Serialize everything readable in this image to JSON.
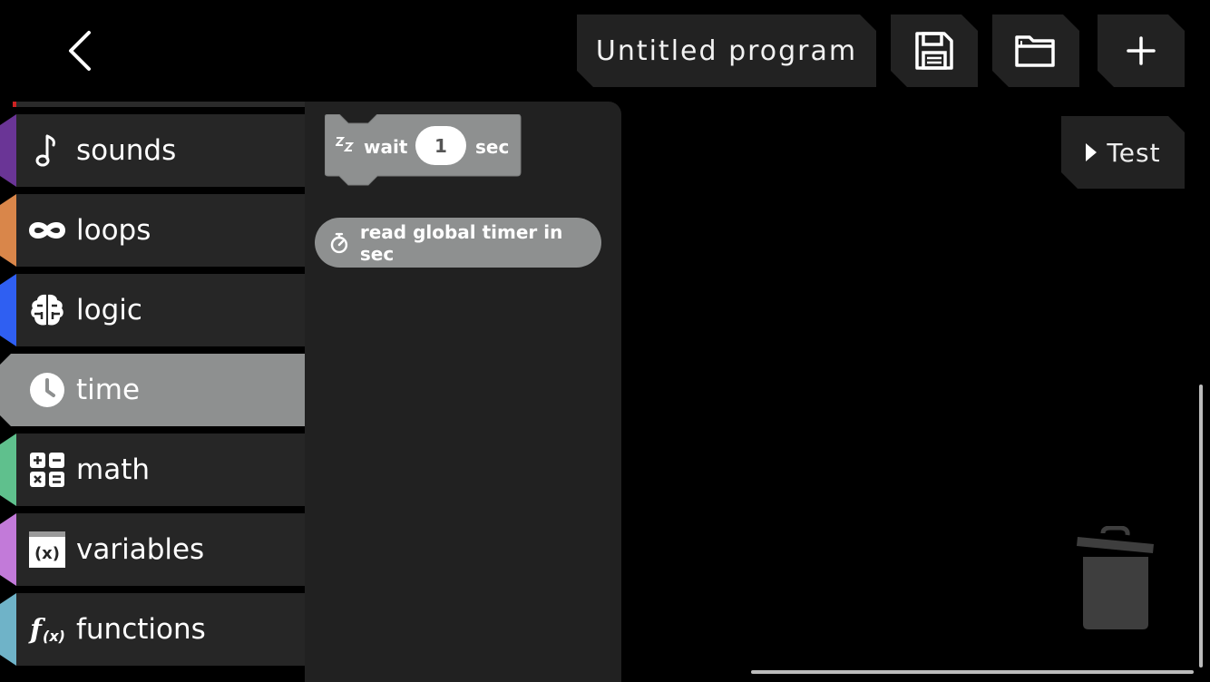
{
  "header": {
    "program_title": "Untitled program",
    "back_icon": "chevron-left-icon",
    "save_icon": "floppy-disk-icon",
    "open_icon": "folder-icon",
    "new_icon": "plus-icon"
  },
  "run": {
    "test_label": "Test",
    "test_icon": "play-triangle-icon"
  },
  "categories": [
    {
      "label": "sounds",
      "icon": "music-note-icon",
      "color": "#6a3596"
    },
    {
      "label": "loops",
      "icon": "infinity-icon",
      "color": "#d9864a"
    },
    {
      "label": "logic",
      "icon": "brain-icon",
      "color": "#2f5ff2"
    },
    {
      "label": "time",
      "icon": "clock-icon",
      "color": "#8e9090",
      "active": true
    },
    {
      "label": "math",
      "icon": "calculator-icon",
      "color": "#5fc08d"
    },
    {
      "label": "variables",
      "icon": "variable-x-icon",
      "color": "#c27ad9"
    },
    {
      "label": "functions",
      "icon": "function-fx-icon",
      "color": "#6fb3c8"
    }
  ],
  "blocks": {
    "wait": {
      "prefix": "wait",
      "value": "1",
      "suffix": "sec",
      "icon": "sleep-zz-icon"
    },
    "timer": {
      "label": "read global timer in sec",
      "icon": "stopwatch-icon"
    }
  },
  "workspace": {
    "trash_icon": "trash-can-icon"
  },
  "colors": {
    "block_gray": "#8e9090",
    "panel": "#212121",
    "button_bg": "#222222"
  }
}
